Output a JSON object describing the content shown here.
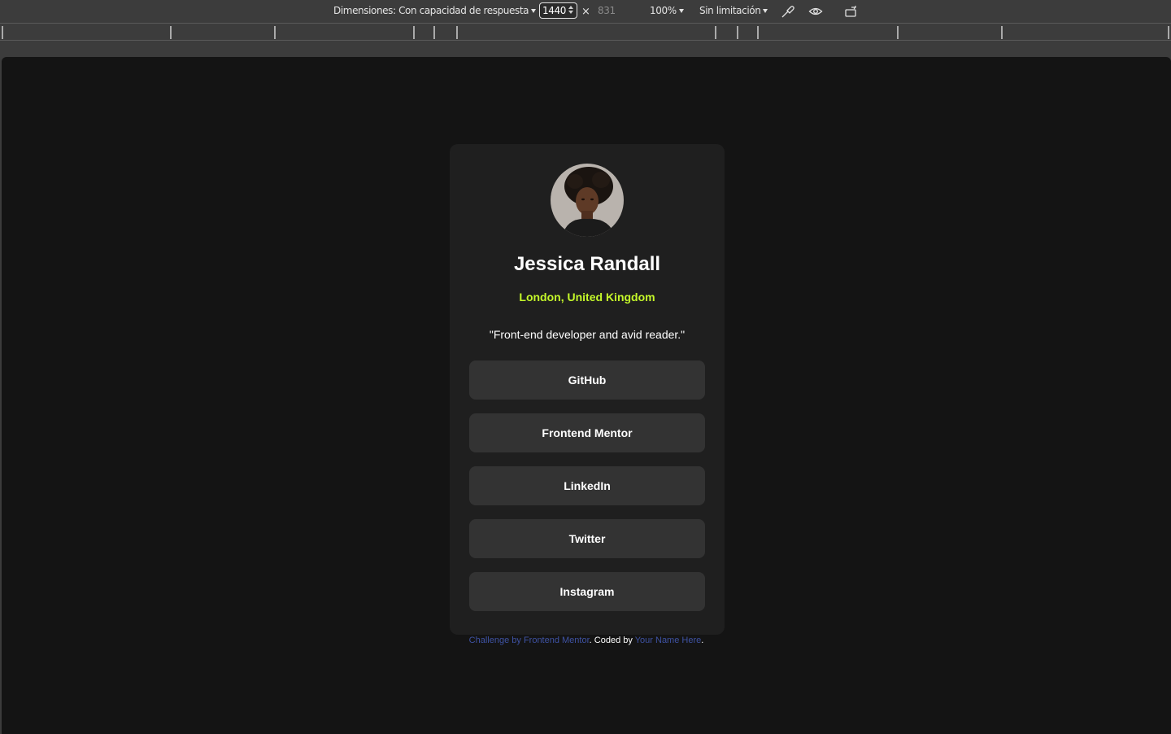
{
  "devtools": {
    "dimensions_label": "Dimensiones: Con capacidad de respuesta",
    "width_value": "1440",
    "times": "×",
    "height_value": "831",
    "zoom": "100%",
    "throttle": "Sin limitación",
    "icons": [
      "eyedropper-icon",
      "eye-icon",
      "rotate-icon"
    ]
  },
  "profile": {
    "name": "Jessica Randall",
    "location": "London, United Kingdom",
    "bio": "\"Front-end developer and avid reader.\"",
    "links": [
      {
        "label": "GitHub"
      },
      {
        "label": "Frontend Mentor"
      },
      {
        "label": "LinkedIn"
      },
      {
        "label": "Twitter"
      },
      {
        "label": "Instagram"
      }
    ]
  },
  "attribution": {
    "challenge_link": "Challenge by Frontend Mentor",
    "middle_text": ". Coded by ",
    "author_link": "Your Name Here",
    "end_text": "."
  },
  "colors": {
    "background": "#141414",
    "card": "#1f1f1f",
    "button": "#333333",
    "accent": "#c4f82a",
    "link": "#3e52a3"
  }
}
